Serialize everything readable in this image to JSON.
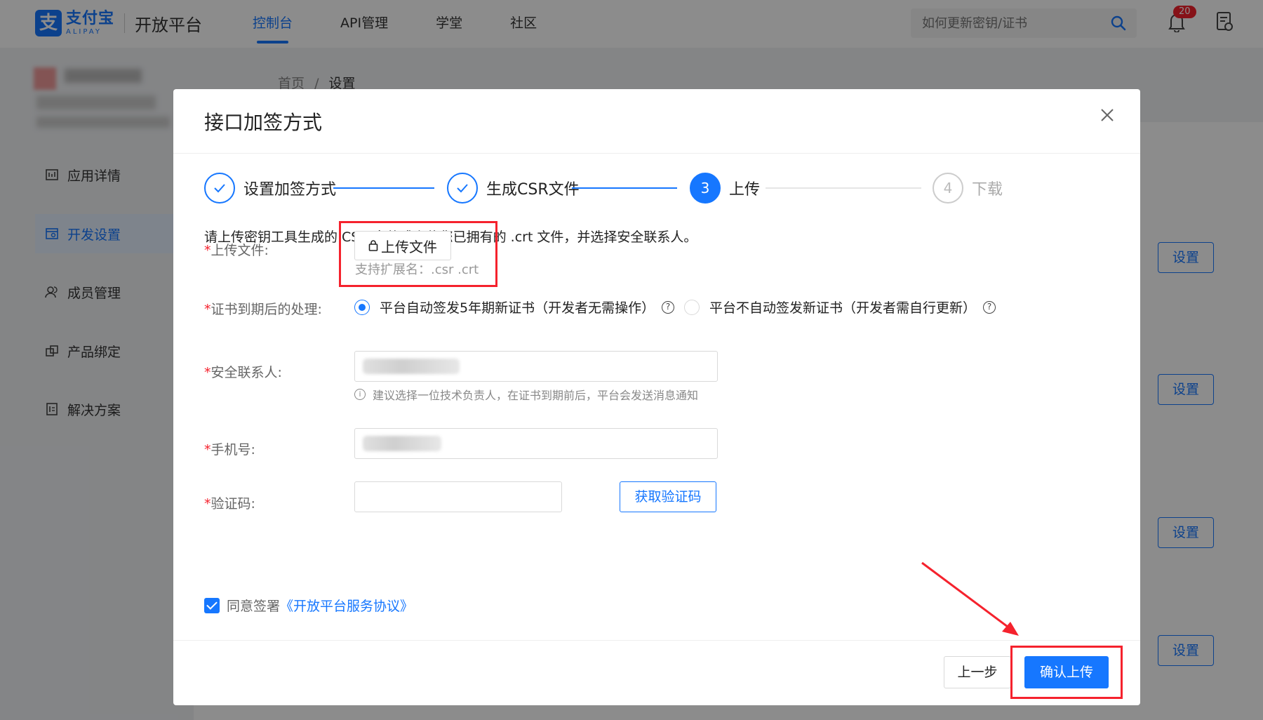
{
  "header": {
    "brand_cn": "支付宝",
    "brand_en": "ALIPAY",
    "platform_title": "开放平台",
    "nav": [
      {
        "label": "控制台",
        "active": true
      },
      {
        "label": "API管理",
        "active": false
      },
      {
        "label": "学堂",
        "active": false
      },
      {
        "label": "社区",
        "active": false
      }
    ],
    "search_placeholder": "如何更新密钥/证书",
    "notification_count": "20"
  },
  "breadcrumb": {
    "home": "首页",
    "separator": "/",
    "current": "设置"
  },
  "sidebar": {
    "items": [
      {
        "label": "应用详情",
        "active": false
      },
      {
        "label": "开发设置",
        "active": true
      },
      {
        "label": "成员管理",
        "active": false
      },
      {
        "label": "产品绑定",
        "active": false
      },
      {
        "label": "解决方案",
        "active": false
      }
    ]
  },
  "background_buttons": [
    "设置",
    "设置",
    "设置",
    "设置"
  ],
  "modal": {
    "title": "接口加签方式",
    "steps": [
      {
        "label": "设置加签方式",
        "state": "done",
        "number": "1"
      },
      {
        "label": "生成CSR文件",
        "state": "done",
        "number": "2"
      },
      {
        "label": "上传",
        "state": "current",
        "number": "3"
      },
      {
        "label": "下载",
        "state": "pending",
        "number": "4"
      }
    ],
    "description": "请上传密钥工具生成的 CSR 文件或上传您已拥有的 .crt 文件，并选择安全联系人。",
    "upload": {
      "label": "上传文件:",
      "button": "上传文件",
      "hint": "支持扩展名：.csr .crt"
    },
    "expiry": {
      "label": "证书到期后的处理:",
      "options": [
        {
          "label": "平台自动签发5年期新证书（开发者无需操作）",
          "checked": true
        },
        {
          "label": "平台不自动签发新证书（开发者需自行更新）",
          "checked": false
        }
      ]
    },
    "contact": {
      "label": "安全联系人:",
      "tip": "建议选择一位技术负责人，在证书到期前后，平台会发送消息通知"
    },
    "phone": {
      "label": "手机号:"
    },
    "code": {
      "label": "验证码:",
      "value": "",
      "button": "获取验证码"
    },
    "agreement": {
      "prefix": "同意签署",
      "link": "《开放平台服务协议》",
      "checked": true
    },
    "footer": {
      "prev": "上一步",
      "confirm": "确认上传"
    }
  },
  "colors": {
    "accent": "#1677ff",
    "annotation": "#f5222d"
  }
}
